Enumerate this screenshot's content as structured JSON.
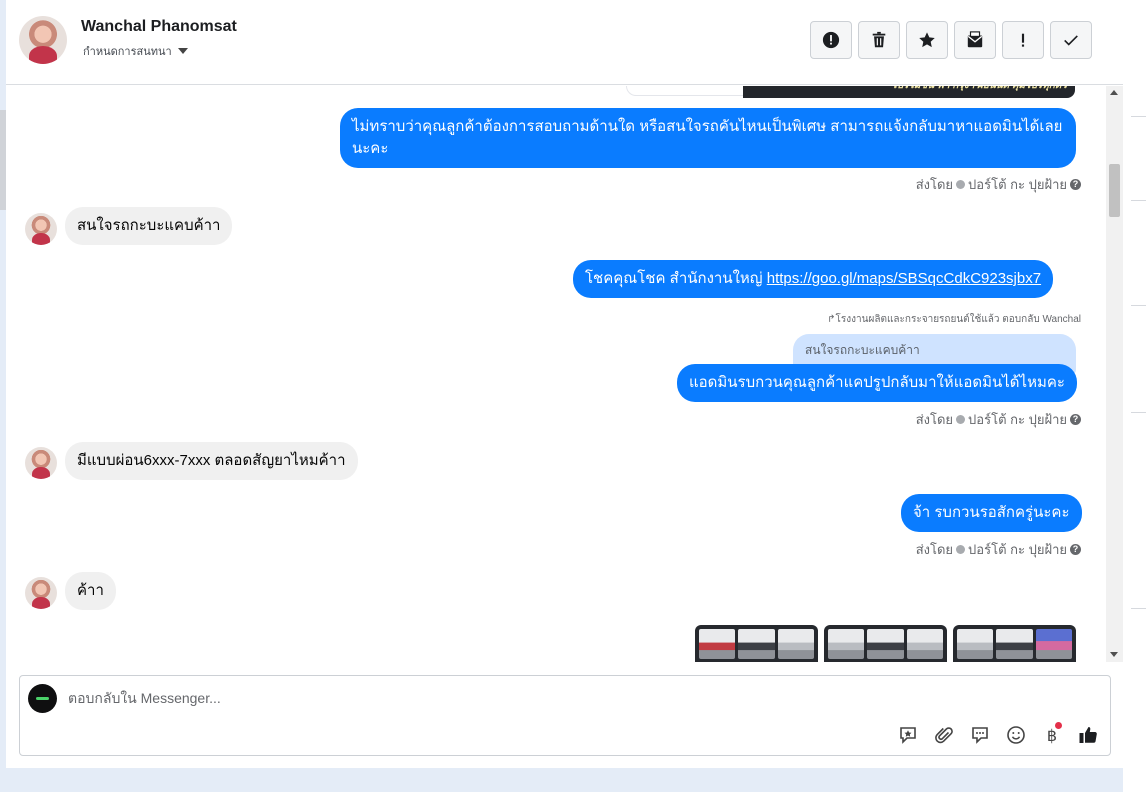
{
  "header": {
    "name": "Wanchal Phanomsat",
    "assign_label": "กำหนดการสนทนา",
    "actions": [
      "alert-circle-icon",
      "trash-icon",
      "star-icon",
      "mark-unread-icon",
      "exclamation-icon",
      "check-icon"
    ]
  },
  "top_image": {
    "caption": "โปรโมชั่น ฟ้า กรุงฯ ผ่อนนิด คุ้มโปรทุกตัว"
  },
  "messages": [
    {
      "side": "out",
      "text": "ไม่ทราบว่าคุณลูกค้าต้องการสอบถามด้านใด หรือสนใจรถคันไหนเป็นพิเศษ สามารถแจ้งกลับมาหาแอดมินได้เลยนะคะ"
    },
    {
      "side": "in",
      "text": "สนใจรถกะบะแคบค้าา"
    },
    {
      "side": "out",
      "text_prefix": "โชคคุณโชค สำนักงานใหญ่ ",
      "link": "https://goo.gl/maps/SBSqcCdkC923sjbx7"
    },
    {
      "side": "out",
      "text": "แอดมินรบกวนคุณลูกค้าแคปรูปกลับมาให้แอดมินได้ไหมคะ"
    },
    {
      "side": "in",
      "text": "มีแบบผ่อน6xxx-7xxx ตลอดสัญยาไหมค้าา"
    },
    {
      "side": "out",
      "text": "จ้า รบกวนรอสักครู่นะคะ"
    },
    {
      "side": "in",
      "text": "ค้าา"
    }
  ],
  "meta": {
    "sent_by": "ส่งโดย",
    "sender": "ปอร์โต้ กะ ปุยฝ้าย"
  },
  "reply_note": "โรงงานผลิตและกระจายรถยนต์ใช้แล้ว ตอบกลับ Wanchal",
  "quoted_text": "สนใจรถกะบะแคบค้าา",
  "composer": {
    "placeholder": "ตอบกลับใน Messenger...",
    "tools": [
      "saved-reply-icon",
      "attachment-icon",
      "chat-bubble-icon",
      "emoji-icon",
      "baht-icon",
      "like-icon"
    ]
  },
  "colors": {
    "outgoing": "#0a7cff",
    "incoming": "#f0f0f0",
    "quoted": "#cfe3ff"
  }
}
